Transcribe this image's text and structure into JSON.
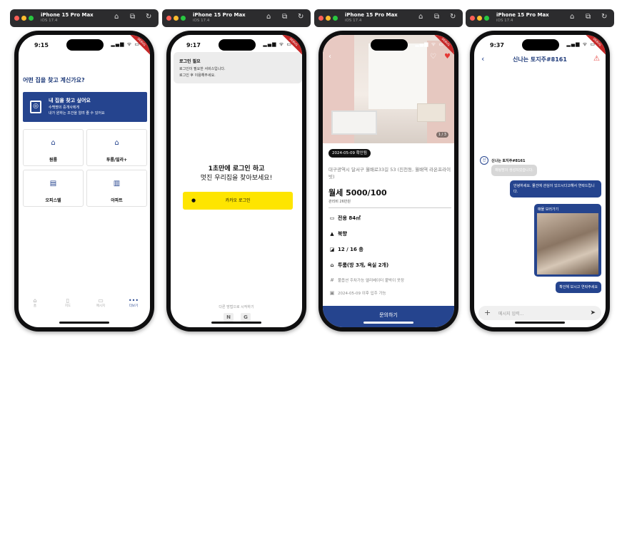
{
  "simulators": [
    {
      "device": "iPhone 15 Pro Max",
      "os": "iOS 17.4"
    },
    {
      "device": "iPhone 15 Pro Max",
      "os": "iOS 17.4"
    },
    {
      "device": "iPhone 15 Pro Max",
      "os": "iOS 17.4"
    },
    {
      "device": "iPhone 15 Pro Max",
      "os": "iOS 17.4"
    }
  ],
  "titlebar_icons": [
    "home-icon",
    "screenshot-icon",
    "rotate-icon"
  ],
  "debug_ribbon": "DEBUG",
  "home_screen": {
    "time": "9:15",
    "question": "어떤 집을 찾고 계신가요?",
    "banner": {
      "title": "내 집을 찾고 싶어요",
      "line1": "수백명의 중개사에게",
      "line2": "내가 원하는 조건을 알려 줄 수 있어요"
    },
    "categories": [
      "원룸",
      "투룸/빌라+",
      "오피스텔",
      "아파트"
    ],
    "tabs": [
      "홈",
      "지도",
      "메시지",
      "더보기"
    ]
  },
  "login_screen": {
    "time": "9:17",
    "toast_title": "로그인 필요",
    "toast_line1": "로그인이 필요한 서비스입니다.",
    "toast_line2": "로그인 후 이용해주세요.",
    "heading1": "1초만에 로그인 하고",
    "heading2": "멋진 우리집을 찾아보세요!",
    "kakao_label": "카카오 로그인",
    "alt_label": "다른 방법으로 시작하기",
    "sns_naver": "N",
    "sns_google": "G"
  },
  "detail_screen": {
    "photo_counter": "1 / 3",
    "date_badge": "2024-05-09 확인됨",
    "address": "대구광역시 달서구 월배로33길 53 (진천동, 월배역 라온프라이빗)",
    "price": "월세 5000/100",
    "maintenance": "관리비 26만원",
    "area": "전용 84㎡",
    "direction": "북향",
    "floor": "12 / 16 층",
    "rooms": "투룸(방 3개, 욕실 2개)",
    "options": "풀옵션 주차가능 엘리베이터 붙박이 옷장",
    "move_in": "2024-05-09 이후 입주 가능",
    "cta": "문의하기",
    "heart_color": "#e53935"
  },
  "chat_screen": {
    "time": "9:37",
    "title": "신나는 토지주#8161",
    "avatar_text": "신",
    "sender": "신나는 토지주#8161",
    "msg_in": "채팅방이 생성되었습니다.",
    "msg_out1": "안녕하세요. 물건에 관심이 있으시다고해서 연락드립니다.",
    "image_label": "매물 보러가기",
    "msg_out2": "확인해 보시고 연락주세요",
    "placeholder": "메시지 입력..."
  },
  "accent_color": "#25448e"
}
